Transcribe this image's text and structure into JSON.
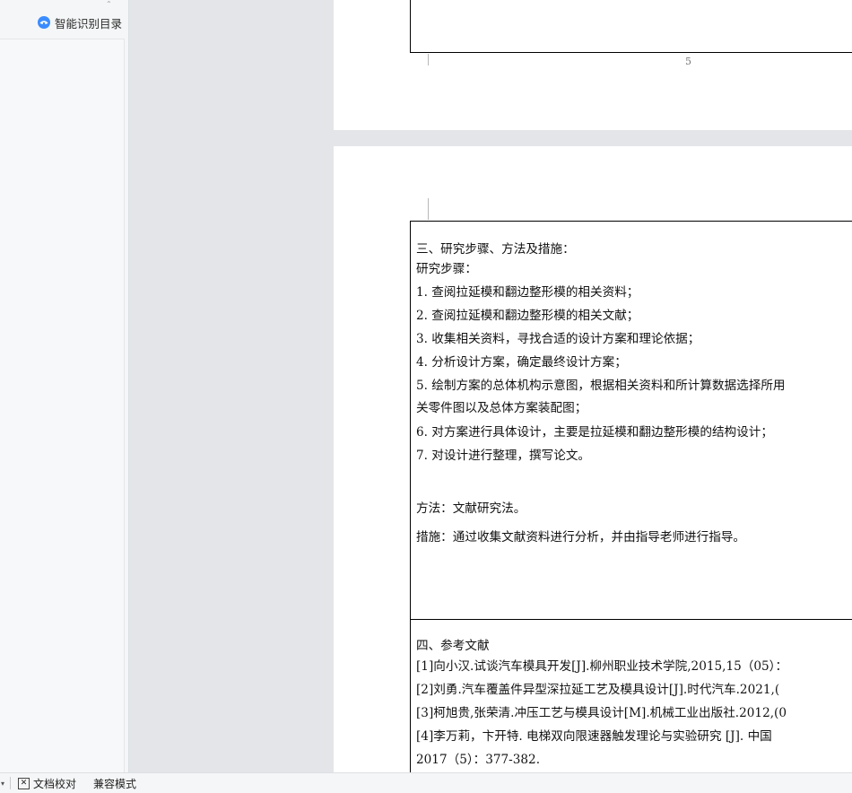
{
  "sidebar": {
    "smart_toc_label": "智能识别目录",
    "smart_toc_icon": "smart-recognize-icon"
  },
  "page_top": {
    "page_number": "5"
  },
  "page_bottom": {
    "section3_lines": [
      "三、研究步骤、方法及措施：",
      "研究步骤：",
      "1. 查阅拉延模和翻边整形模的相关资料；",
      "2. 查阅拉延模和翻边整形模的相关文献；",
      "3. 收集相关资料，寻找合适的设计方案和理论依据；",
      "4. 分析设计方案，确定最终设计方案；",
      "5. 绘制方案的总体机构示意图，根据相关资料和所计算数据选择所用",
      "关零件图以及总体方案装配图；",
      "6. 对方案进行具体设计，主要是拉延模和翻边整形模的结构设计；",
      "7. 对设计进行整理，撰写论文。",
      "方法：文献研究法。",
      "措施：通过收集文献资料进行分析，并由指导老师进行指导。"
    ],
    "section4_lines": [
      "四、参考文献",
      "[1]向小汉.试谈汽车模具开发[J].柳州职业技术学院,2015,15（05）：",
      "[2]刘勇.汽车覆盖件异型深拉延工艺及模具设计[J].时代汽车.2021,(",
      "[3]柯旭贵,张荣清.冲压工艺与模具设计[M].机械工业出版社.2012,(0",
      "[4]李万莉，卞开特. 电梯双向限速器触发理论与实验研究 [J]. 中国",
      "2017（5）：377-382."
    ]
  },
  "statusbar": {
    "dropdown_icon": "caret-down-icon",
    "proofread_label": "文档校对",
    "proofread_icon": "close-box-icon",
    "compat_label": "兼容模式"
  }
}
